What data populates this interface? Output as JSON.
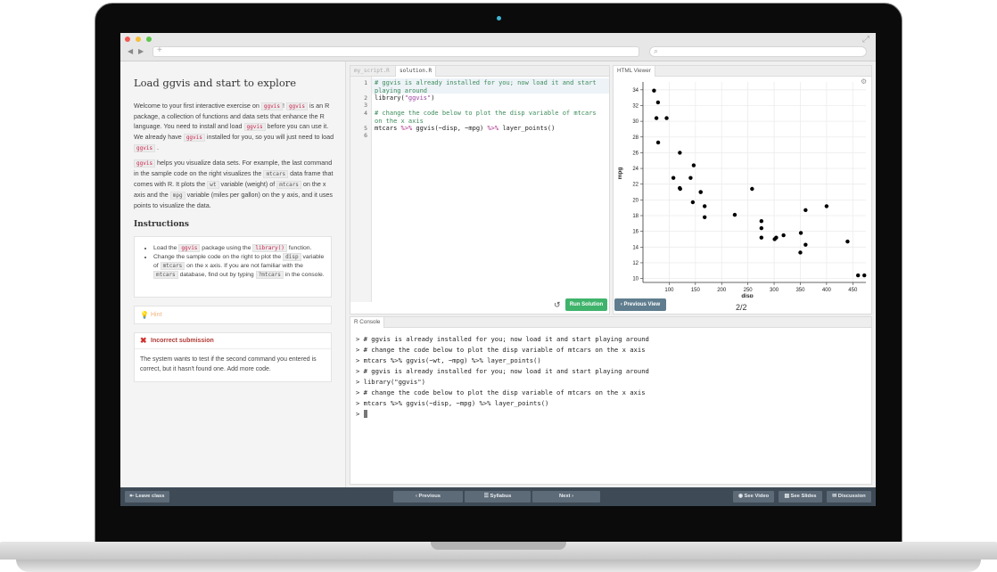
{
  "browser": {
    "url_placeholder": "+",
    "search_icon": "search-icon",
    "nav_back": "◀",
    "nav_forward": "▶"
  },
  "lesson": {
    "title": "Load ggvis and start to explore",
    "p1": {
      "t1": "Welcome to your first interactive exercise on ",
      "c1": "ggvis",
      "t2": "! ",
      "c2": "ggvis",
      "t3": " is an R package, a collection of functions and data sets that enhance the R language. You need to install and load ",
      "c3": "ggvis",
      "t4": " before you can use it. We already have ",
      "c4": "ggvis",
      "t5": " installed for you, so you will just need to load ",
      "c5": "ggvis",
      "t6": " ."
    },
    "p2": {
      "c1": "ggvis",
      "t1": " helps you visualize data sets. For example, the last command in the sample code on the right visualizes the ",
      "c2": "mtcars",
      "t2": " data frame that comes with R. It plots the ",
      "c3": "wt",
      "t3": " variable (weight) of ",
      "c4": "mtcars",
      "t4": " on the x axis and the ",
      "c5": "mpg",
      "t5": " variable (miles per gallon) on the y axis, and it uses points to visualize the data."
    },
    "instructions_heading": "Instructions",
    "instr1": {
      "t1": "Load the ",
      "c1": "ggvis",
      "t2": " package using the ",
      "c2": "library()",
      "t3": " function."
    },
    "instr2": {
      "t1": "Change the sample code on the right to plot the ",
      "c1": "disp",
      "t2": " variable of ",
      "c2": "mtcars",
      "t3": " on the x axis. If you are not familiar with the ",
      "c3": "mtcars",
      "t4": " database, find out by typing ",
      "c4": "?mtcars",
      "t5": " in the console."
    },
    "hint_label": "Hint",
    "error_title": "Incorrect submission",
    "error_body": "The system wants to test if the second command you entered is correct, but it hasn't found one. Add more code."
  },
  "editor": {
    "tabs": [
      "my_script.R",
      "solution.R"
    ],
    "active_tab": "solution.R",
    "line_numbers": [
      "1",
      "2",
      "3",
      "4",
      "5",
      "6"
    ],
    "lines": {
      "l1a": "# ggvis is already installed for you; now load it and start",
      "l1b": "playing around",
      "l2a": "library(",
      "l2b": "\"ggvis\"",
      "l2c": ")",
      "l4a": "# change the code below to plot the disp variable of mtcars",
      "l4b": "on the x axis",
      "l5a": "mtcars ",
      "l5b": "%>%",
      "l5c": " ggvis(~disp, ~mpg) ",
      "l5d": "%>%",
      "l5e": " layer_points()"
    },
    "run_button": "Run Solution"
  },
  "viewer": {
    "tab": "HTML Viewer",
    "prev_button": "Previous View",
    "page": "2/2"
  },
  "chart_data": {
    "type": "scatter",
    "title": "",
    "xlabel": "disp",
    "ylabel": "mpg",
    "xlim": [
      50,
      475
    ],
    "ylim": [
      9.5,
      35
    ],
    "x_ticks": [
      100,
      150,
      200,
      250,
      300,
      350,
      400,
      450
    ],
    "y_ticks": [
      10,
      12,
      14,
      16,
      18,
      20,
      22,
      24,
      26,
      28,
      30,
      32,
      34
    ],
    "grid": true,
    "x": [
      160,
      160,
      108,
      258,
      360,
      225,
      360,
      146.7,
      140.8,
      167.6,
      167.6,
      275.8,
      275.8,
      275.8,
      472,
      460,
      440,
      78.7,
      75.7,
      71.1,
      120.1,
      318,
      304,
      350,
      400,
      79,
      120.3,
      95.1,
      351,
      145,
      301,
      121
    ],
    "y": [
      21,
      21,
      22.8,
      21.4,
      18.7,
      18.1,
      14.3,
      24.4,
      22.8,
      19.2,
      17.8,
      16.4,
      17.3,
      15.2,
      10.4,
      10.4,
      14.7,
      32.4,
      30.4,
      33.9,
      21.5,
      15.5,
      15.2,
      13.3,
      19.2,
      27.3,
      26,
      30.4,
      15.8,
      19.7,
      15,
      21.4
    ]
  },
  "console": {
    "tab": "R Console",
    "lines": [
      "> # ggvis is already installed for you; now load it and start playing around",
      "> # change the code below to plot the disp variable of mtcars on the x axis",
      "> mtcars %>% ggvis(~wt, ~mpg) %>% layer_points()",
      "> # ggvis is already installed for you; now load it and start playing around",
      "> library(\"ggvis\")",
      "> # change the code below to plot the disp variable of mtcars on the x axis",
      "> mtcars %>% ggvis(~disp, ~mpg) %>% layer_points()"
    ],
    "prompt": "> "
  },
  "bottom": {
    "leave": "Leave class",
    "previous": "Previous",
    "syllabus": "Syllabus",
    "next": "Next",
    "see_video": "See Video",
    "see_slides": "See Slides",
    "discussion": "Discussion"
  },
  "colors": {
    "run_button": "#3fb36b",
    "prev_view_button": "#5f7d8e",
    "bottom_bar": "#3e4b57",
    "error_red": "#d0312d"
  }
}
